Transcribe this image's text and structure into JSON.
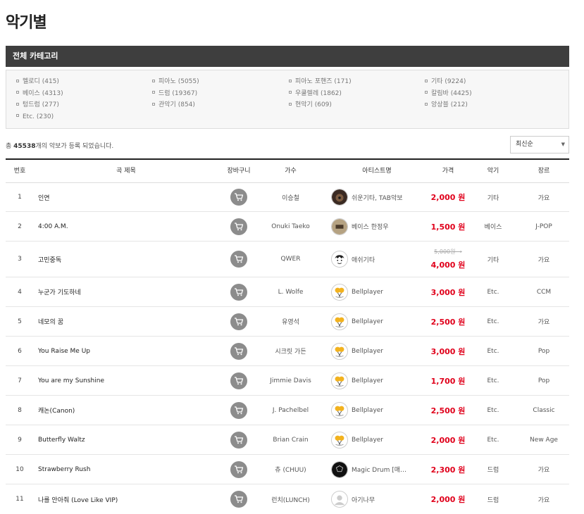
{
  "page": {
    "title": "악기별"
  },
  "category": {
    "header": "전체 카테고리",
    "items": [
      "멜로디 (415)",
      "피아노 (5055)",
      "피아노 포핸즈 (171)",
      "기타 (9224)",
      "베이스 (4313)",
      "드럼 (19367)",
      "우쿨렐레 (1862)",
      "칼림바 (4425)",
      "텅드럼 (277)",
      "관악기 (854)",
      "현악기 (609)",
      "앙상블 (212)",
      "Etc. (230)"
    ]
  },
  "summary": {
    "prefix": "총",
    "count": "45538",
    "suffix": "개의 악보가 등록 되었습니다."
  },
  "sort": {
    "selected": "최신순",
    "caret": "▼"
  },
  "table": {
    "headers": {
      "num": "번호",
      "title": "곡 제목",
      "cart": "장바구니",
      "singer": "가수",
      "artist": "아티스트명",
      "price": "가격",
      "instrument": "악기",
      "genre": "장르"
    },
    "rows": [
      {
        "num": "1",
        "title": "인연",
        "singer": "이승철",
        "artist": "쉬운기타, TAB악보",
        "avatar": "dark-guitar",
        "old_price": "",
        "price": "2,000 원",
        "instrument": "기타",
        "genre": "가요"
      },
      {
        "num": "2",
        "title": "4:00 A.M.",
        "singer": "Onuki Taeko",
        "artist": "베이스 한정우",
        "avatar": "bass-logo",
        "old_price": "",
        "price": "1,500 원",
        "instrument": "베이스",
        "genre": "J-POP"
      },
      {
        "num": "3",
        "title": "고민중독",
        "singer": "QWER",
        "artist": "애쉬기타",
        "avatar": "sketch-face",
        "old_price": "5,000원 →",
        "price": "4,000 원",
        "instrument": "기타",
        "genre": "가요"
      },
      {
        "num": "4",
        "title": "누군가 기도하네",
        "singer": "L. Wolfe",
        "artist": "Bellplayer",
        "avatar": "bells",
        "old_price": "",
        "price": "3,000 원",
        "instrument": "Etc.",
        "genre": "CCM"
      },
      {
        "num": "5",
        "title": "네모의 꿈",
        "singer": "유영석",
        "artist": "Bellplayer",
        "avatar": "bells",
        "old_price": "",
        "price": "2,500 원",
        "instrument": "Etc.",
        "genre": "가요"
      },
      {
        "num": "6",
        "title": "You Raise Me Up",
        "singer": "시크릿 가든",
        "artist": "Bellplayer",
        "avatar": "bells",
        "old_price": "",
        "price": "3,000 원",
        "instrument": "Etc.",
        "genre": "Pop"
      },
      {
        "num": "7",
        "title": "You are my Sunshine",
        "singer": "Jimmie Davis",
        "artist": "Bellplayer",
        "avatar": "bells",
        "old_price": "",
        "price": "1,700 원",
        "instrument": "Etc.",
        "genre": "Pop"
      },
      {
        "num": "8",
        "title": "캐논(Canon)",
        "singer": "J. Pachelbel",
        "artist": "Bellplayer",
        "avatar": "bells",
        "old_price": "",
        "price": "2,500 원",
        "instrument": "Etc.",
        "genre": "Classic"
      },
      {
        "num": "9",
        "title": "Butterfly Waltz",
        "singer": "Brian Crain",
        "artist": "Bellplayer",
        "avatar": "bells",
        "old_price": "",
        "price": "2,000 원",
        "instrument": "Etc.",
        "genre": "New Age"
      },
      {
        "num": "10",
        "title": "Strawberry Rush",
        "singer": "츄 (CHUU)",
        "artist": "Magic Drum [매…",
        "avatar": "black-drum",
        "old_price": "",
        "price": "2,300 원",
        "instrument": "드럼",
        "genre": "가요"
      },
      {
        "num": "11",
        "title": "나를 안아줘 (Love Like VIP)",
        "singer": "런치(LUNCH)",
        "artist": "아기나무",
        "avatar": "default-user",
        "old_price": "",
        "price": "2,000 원",
        "instrument": "드럼",
        "genre": "가요"
      }
    ]
  },
  "colors": {
    "header_bar": "#3e3e3e",
    "price": "#e0001b",
    "cart_button": "#8c8c8c"
  }
}
